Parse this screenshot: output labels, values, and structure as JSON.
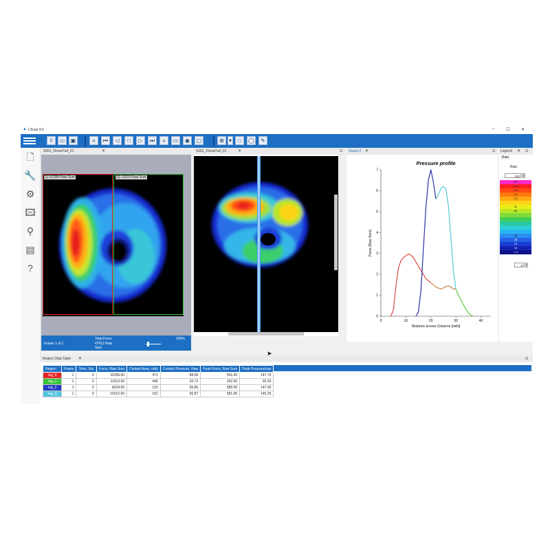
{
  "app": {
    "title": "I-Scan 9.0",
    "window_controls": [
      "–",
      "☐",
      "✕"
    ]
  },
  "toolbar": {
    "groups": [
      [
        "export-icon",
        "open-icon",
        "save-icon"
      ],
      [
        "rewind-icon",
        "first-frame-icon",
        "step-back-icon",
        "stop-icon",
        "play-icon",
        "last-frame-icon",
        "forward-icon",
        "record-icon",
        "camera-icon",
        "window-icon"
      ],
      [
        "grid-icon",
        "rectangle-icon",
        "ellipse-icon",
        "pen-icon"
      ]
    ]
  },
  "sidebar": {
    "items": [
      "document-icon",
      "wrench-icon",
      "gear-icon",
      "image-icon",
      "user-search-icon",
      "chart-icon",
      "help-icon"
    ]
  },
  "views": {
    "left": {
      "tab": "S051_Donut7a4_01",
      "region_red_label": "[1] 52288 Raw Sum",
      "region_green_label": "[2] 13333 Raw Sum",
      "footer": {
        "frame": "Frame 1 of 1",
        "total_force_label": "Total Force",
        "total_force_value": "47912 Raw",
        "total_force_unit": "Sum",
        "zoom": "100%"
      }
    },
    "middle": {
      "tab": "S181_Donut7a4_01"
    },
    "graph": {
      "tab": "Graph-2"
    },
    "legend": {
      "tab": "Legend",
      "subtab": "Raw",
      "heading": "Raw",
      "top_value": "150",
      "bottom_value": "0",
      "rows": [
        {
          "label": "255",
          "color": "#ff29c8"
        },
        {
          "label": "≥ 141",
          "color": "#ff1f1f"
        },
        {
          "label": "132",
          "color": "#ff4a14"
        },
        {
          "label": "122",
          "color": "#ff7a0e"
        },
        {
          "label": "113",
          "color": "#ffa810"
        },
        {
          "label": "",
          "color": "#ffd417"
        },
        {
          "label": "94",
          "color": "#e8ee16"
        },
        {
          "label": "85",
          "color": "#b8e627"
        },
        {
          "label": "",
          "color": "#7fd93a"
        },
        {
          "label": "",
          "color": "#3fcf5a"
        },
        {
          "label": "",
          "color": "#27c9a0"
        },
        {
          "label": "",
          "color": "#2ed0d6"
        },
        {
          "label": "",
          "color": "#27b6ee"
        },
        {
          "label": "38",
          "color": "#2a8ef0"
        },
        {
          "label": "28",
          "color": "#2364e6"
        },
        {
          "label": "19",
          "color": "#1a3cd2"
        },
        {
          "label": "10",
          "color": "#1521b2"
        },
        {
          "label": "> 0",
          "color": "#0d1488"
        }
      ]
    }
  },
  "chart_data": {
    "type": "line",
    "title": "Pressure profile",
    "xlabel": "Distance across Columns [cells]",
    "ylabel": "Force [Raw Sum]",
    "xlim": [
      0,
      44
    ],
    "ylim": [
      0,
      7
    ],
    "xticks": [
      0,
      10,
      20,
      30,
      40
    ],
    "yticks": [
      0,
      1,
      2,
      3,
      4,
      5,
      6,
      7
    ],
    "grid": false,
    "series": [
      {
        "color": "#d9473f",
        "x": [
          4,
          5,
          6,
          7,
          8,
          9,
          10,
          11,
          12,
          13,
          14,
          15,
          16,
          17,
          18,
          19,
          20
        ],
        "y": [
          0,
          0.3,
          1.4,
          2.3,
          2.65,
          2.8,
          2.9,
          2.97,
          2.93,
          2.8,
          2.6,
          2.4,
          2.2,
          2.0,
          1.8,
          1.7,
          1.6
        ]
      },
      {
        "color": "#2a2fa8",
        "x": [
          14,
          15,
          16,
          17,
          18,
          19,
          20,
          21,
          22
        ],
        "y": [
          0,
          0.2,
          1.2,
          3.2,
          5.2,
          6.5,
          7.0,
          6.4,
          5.6
        ]
      },
      {
        "color": "#52c9d4",
        "x": [
          22,
          23,
          24,
          25,
          26,
          27,
          28,
          29,
          30
        ],
        "y": [
          5.6,
          5.8,
          6.1,
          6.2,
          6.1,
          5.3,
          3.8,
          2.2,
          1.3
        ]
      },
      {
        "color": "#5ccc3a",
        "x": [
          30,
          31,
          32,
          33,
          34,
          35,
          36,
          37
        ],
        "y": [
          1.3,
          1.0,
          0.8,
          0.55,
          0.35,
          0.15,
          0.05,
          0
        ]
      },
      {
        "color": "#c8824a",
        "x": [
          20,
          21,
          22,
          23,
          24,
          25,
          26,
          27,
          28,
          29,
          30
        ],
        "y": [
          1.6,
          1.5,
          1.4,
          1.35,
          1.3,
          1.35,
          1.42,
          1.45,
          1.4,
          1.3,
          1.3
        ]
      }
    ]
  },
  "region_table": {
    "tab": "Region Data Table",
    "columns": [
      "Region",
      "Frame",
      "Time, Sec",
      "Force, Raw Sum",
      "Contact Area, cells",
      "Contact Pressure, Raw",
      "Peak Force, Raw Sum",
      "Peak Pressure/raw"
    ],
    "rows": [
      {
        "region": "reg_0",
        "color": "#e32626",
        "cells": [
          "1",
          "0",
          "32299.00",
          "471",
          "68.58",
          "591.00",
          "147.75"
        ]
      },
      {
        "region": "reg_1",
        "color": "#39c43a",
        "cells": [
          "1",
          "0",
          "13113.00",
          "449",
          "33.73",
          "262.00",
          "65.50"
        ]
      },
      {
        "region": "reg_2",
        "color": "#2339c8",
        "cells": [
          "1",
          "0",
          "8224.00",
          "123",
          "66.86",
          "589.00",
          "147.00"
        ]
      },
      {
        "region": "reg_3",
        "color": "#55c7e0",
        "cells": [
          "1",
          "0",
          "10012.00",
          "152",
          "65.87",
          "581.00",
          "145.25"
        ]
      }
    ]
  }
}
